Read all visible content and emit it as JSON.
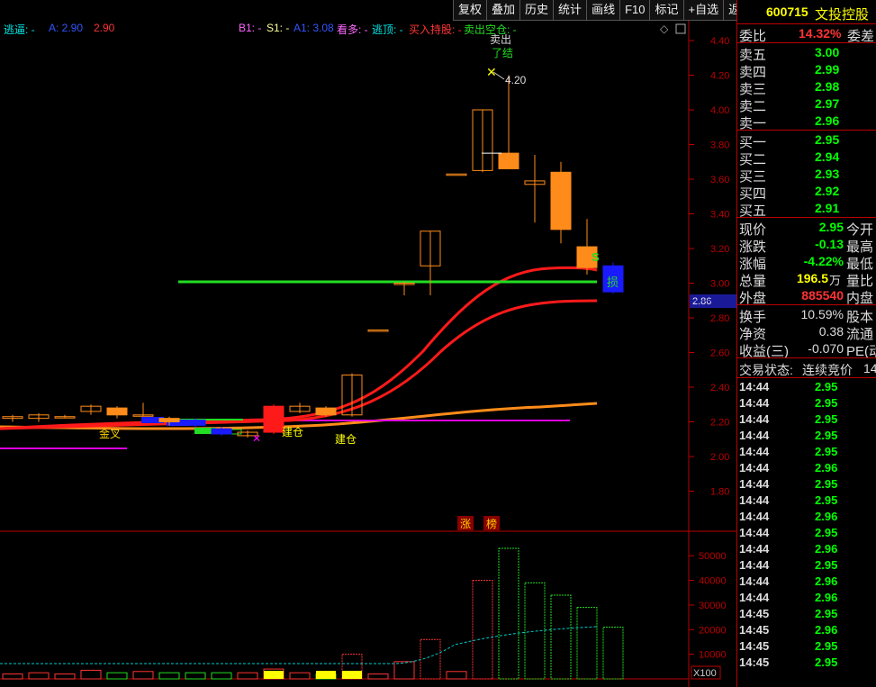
{
  "toolbar": {
    "items": [
      "复权",
      "叠加",
      "历史",
      "统计",
      "画线",
      "F10",
      "标记",
      "+自选",
      "返回"
    ]
  },
  "legend": {
    "escape": "逃逼: -",
    "a": "A: 2.90",
    "a2": "2.90",
    "b1": "B1: -",
    "s1": "S1: -",
    "a1": "A1: 3.08",
    "bull": "看多: -",
    "top": "逃顶: -",
    "buy_hold": "买入持股: -",
    "sell_short": "卖出空仓: -"
  },
  "price_axis": {
    "labels": [
      "4.40",
      "4.20",
      "4.00",
      "3.80",
      "3.60",
      "3.40",
      "3.20",
      "3.00",
      "2.80",
      "2.60",
      "2.40",
      "2.20",
      "2.00",
      "1.80"
    ],
    "current_price_tag": "2.86"
  },
  "volume_axis": {
    "labels": [
      "50000",
      "40000",
      "30000",
      "20000",
      "10000"
    ],
    "unit": "X100"
  },
  "annotations": {
    "sell_top": "卖出",
    "done": "了结",
    "high_price": "4.20",
    "stop_loss_s": "S",
    "stop_loss": "损",
    "golden_cross": "金叉",
    "build1": "建仓",
    "build2": "建仓",
    "limit_up_1": "涨",
    "limit_up_2": "榜"
  },
  "chart_data": {
    "type": "candlestick",
    "price_range": [
      1.7,
      4.48
    ],
    "volume_range": [
      0,
      57000
    ],
    "candles": [
      {
        "open": 2.22,
        "close": 2.23,
        "high": 2.24,
        "low": 2.2,
        "volume": 2000,
        "dir": "up"
      },
      {
        "open": 2.22,
        "close": 2.24,
        "high": 2.25,
        "low": 2.2,
        "volume": 2500,
        "dir": "up"
      },
      {
        "open": 2.23,
        "close": 2.23,
        "high": 2.24,
        "low": 2.22,
        "volume": 2000,
        "dir": "up"
      },
      {
        "open": 2.26,
        "close": 2.29,
        "high": 2.3,
        "low": 2.24,
        "volume": 3500,
        "dir": "up"
      },
      {
        "open": 2.28,
        "close": 2.24,
        "high": 2.29,
        "low": 2.22,
        "volume": 2500,
        "dir": "down"
      },
      {
        "open": 2.24,
        "close": 2.24,
        "high": 2.31,
        "low": 2.23,
        "volume": 3000,
        "dir": "up"
      },
      {
        "open": 2.22,
        "close": 2.2,
        "high": 2.23,
        "low": 2.18,
        "volume": 2500,
        "dir": "down"
      },
      {
        "open": 2.21,
        "close": 2.18,
        "high": 2.22,
        "low": 2.17,
        "volume": 2500,
        "dir": "down"
      },
      {
        "open": 2.16,
        "close": 2.13,
        "high": 2.17,
        "low": 2.12,
        "volume": 2500,
        "dir": "down"
      },
      {
        "open": 2.12,
        "close": 2.14,
        "high": 2.15,
        "low": 2.11,
        "volume": 2500,
        "dir": "up"
      },
      {
        "open": 2.14,
        "close": 2.29,
        "high": 2.3,
        "low": 2.13,
        "volume": 4000,
        "dir": "up"
      },
      {
        "open": 2.26,
        "close": 2.29,
        "high": 2.31,
        "low": 2.25,
        "volume": 2500,
        "dir": "up"
      },
      {
        "open": 2.28,
        "close": 2.24,
        "high": 2.29,
        "low": 2.23,
        "volume": 2000,
        "dir": "down"
      },
      {
        "open": 2.24,
        "close": 2.47,
        "high": 2.48,
        "low": 2.23,
        "volume": 10000,
        "dir": "up"
      },
      {
        "open": 2.73,
        "close": 2.73,
        "high": 2.73,
        "low": 2.73,
        "volume": 2000,
        "dir": "up"
      },
      {
        "open": 3.0,
        "close": 3.0,
        "high": 3.01,
        "low": 2.93,
        "volume": 7000,
        "dir": "up"
      },
      {
        "open": 3.1,
        "close": 3.3,
        "high": 3.3,
        "low": 2.93,
        "volume": 16000,
        "dir": "up"
      },
      {
        "open": 3.63,
        "close": 3.63,
        "high": 3.63,
        "low": 3.63,
        "volume": 3000,
        "dir": "up"
      },
      {
        "open": 3.65,
        "close": 4.0,
        "high": 4.0,
        "low": 3.64,
        "volume": 40000,
        "dir": "up"
      },
      {
        "open": 3.75,
        "close": 3.66,
        "high": 4.2,
        "low": 3.66,
        "volume": 53000,
        "dir": "down"
      },
      {
        "open": 3.59,
        "close": 3.57,
        "high": 3.74,
        "low": 3.35,
        "volume": 39000,
        "dir": "down"
      },
      {
        "open": 3.64,
        "close": 3.31,
        "high": 3.7,
        "low": 3.23,
        "volume": 34000,
        "dir": "down"
      },
      {
        "open": 3.21,
        "close": 3.09,
        "high": 3.37,
        "low": 3.05,
        "volume": 29000,
        "dir": "down"
      },
      {
        "open": 3.1,
        "close": 2.95,
        "high": 3.12,
        "low": 2.94,
        "volume": 21000,
        "dir": "down"
      }
    ]
  },
  "quote": {
    "code": "600715",
    "name": "文投控股",
    "webi_label": "委比",
    "webi_value": "14.32%",
    "wecha_label": "委差",
    "asks": [
      {
        "label": "卖五",
        "price": "3.00"
      },
      {
        "label": "卖四",
        "price": "2.99"
      },
      {
        "label": "卖三",
        "price": "2.98"
      },
      {
        "label": "卖二",
        "price": "2.97"
      },
      {
        "label": "卖一",
        "price": "2.96"
      }
    ],
    "bids": [
      {
        "label": "买一",
        "price": "2.95"
      },
      {
        "label": "买二",
        "price": "2.94"
      },
      {
        "label": "买三",
        "price": "2.93"
      },
      {
        "label": "买四",
        "price": "2.92"
      },
      {
        "label": "买五",
        "price": "2.91"
      }
    ],
    "stats": [
      {
        "label": "现价",
        "value": "2.95",
        "label2": "今开",
        "color": "#00ff00"
      },
      {
        "label": "涨跌",
        "value": "-0.13",
        "label2": "最高",
        "color": "#00ff00"
      },
      {
        "label": "涨幅",
        "value": "-4.22%",
        "label2": "最低",
        "color": "#00ff00"
      },
      {
        "label": "总量",
        "value": "196.5",
        "unit": "万",
        "label2": "量比",
        "color": "#ffff00"
      },
      {
        "label": "外盘",
        "value": "885540",
        "label2": "内盘",
        "color": "#ff3333"
      }
    ],
    "stats2": [
      {
        "label": "换手",
        "value": "10.59%",
        "label2": "股本"
      },
      {
        "label": "净资",
        "value": "0.38",
        "label2": "流通"
      },
      {
        "label": "收益(三)",
        "value": "-0.070",
        "label2": "PE(动)"
      }
    ],
    "trade_status_label": "交易状态:",
    "trade_status": "连续竞价",
    "trade_status_tail": "14",
    "ticks": [
      {
        "time": "14:44",
        "price": "2.95"
      },
      {
        "time": "14:44",
        "price": "2.95"
      },
      {
        "time": "14:44",
        "price": "2.95"
      },
      {
        "time": "14:44",
        "price": "2.95"
      },
      {
        "time": "14:44",
        "price": "2.95"
      },
      {
        "time": "14:44",
        "price": "2.96"
      },
      {
        "time": "14:44",
        "price": "2.95"
      },
      {
        "time": "14:44",
        "price": "2.95"
      },
      {
        "time": "14:44",
        "price": "2.96"
      },
      {
        "time": "14:44",
        "price": "2.95"
      },
      {
        "time": "14:44",
        "price": "2.96"
      },
      {
        "time": "14:44",
        "price": "2.95"
      },
      {
        "time": "14:44",
        "price": "2.96"
      },
      {
        "time": "14:44",
        "price": "2.96"
      },
      {
        "time": "14:45",
        "price": "2.95"
      },
      {
        "time": "14:45",
        "price": "2.96"
      },
      {
        "time": "14:45",
        "price": "2.95"
      },
      {
        "time": "14:45",
        "price": "2.95"
      }
    ]
  },
  "colors": {
    "up": "#ff3333",
    "down": "#00ff00",
    "frame": "#bb0000",
    "orange": "#ff8c1a",
    "blue": "#1a1aff",
    "green": "#22dd22",
    "magenta": "#dd00dd"
  }
}
